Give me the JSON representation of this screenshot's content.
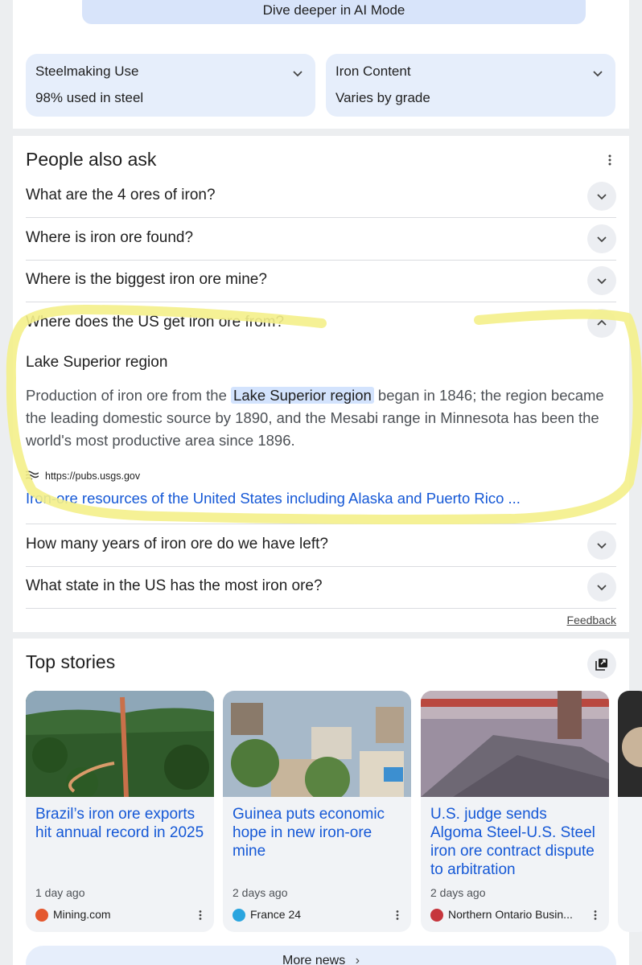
{
  "ai_mode": {
    "label": "Dive deeper in AI Mode"
  },
  "chips": [
    {
      "title": "Steelmaking Use",
      "value": "98% used in steel"
    },
    {
      "title": "Iron Content",
      "value": "Varies by grade"
    }
  ],
  "people_also_ask": {
    "title": "People also ask",
    "questions": [
      "What are the 4 ores of iron?",
      "Where is iron ore found?",
      "Where is the biggest iron ore mine?",
      "Where does the US get iron ore from?",
      "How many years of iron ore do we have left?",
      "What state in the US has the most iron ore?"
    ],
    "expanded_answer": {
      "short": "Lake Superior region",
      "body_before": "Production of iron ore from the",
      "body_highlight": "Lake Superior region",
      "body_after": "began in 1846; the region became the leading domestic source by 1890, and the Mesabi range in Minnesota has been the world's most productive area since 1896.",
      "source_url": "https://pubs.usgs.gov",
      "source_title": "Iron-ore resources of the United States including Alaska and Puerto Rico ..."
    },
    "feedback": "Feedback"
  },
  "top_stories": {
    "title": "Top stories",
    "items": [
      {
        "title": "Brazil’s iron ore exports hit annual record in 2025",
        "time": "1 day ago",
        "source": "Mining.com"
      },
      {
        "title": "Guinea puts economic hope in new iron-ore mine",
        "time": "2 days ago",
        "source": "France 24"
      },
      {
        "title": "U.S. judge sends Algoma Steel-U.S. Steel iron ore contract dispute to arbitration",
        "time": "2 days ago",
        "source": "Northern Ontario Busin..."
      }
    ],
    "more_news": "More news"
  },
  "colors": {
    "link": "#1558d6",
    "chip_bg": "#e6eefb",
    "highlight_marker": "#f4f08a"
  },
  "icons": [
    "chevron-down-icon",
    "chevron-up-icon",
    "more-vert-icon",
    "usgs-logo",
    "open-in-new-icon",
    "chevron-right-icon"
  ]
}
